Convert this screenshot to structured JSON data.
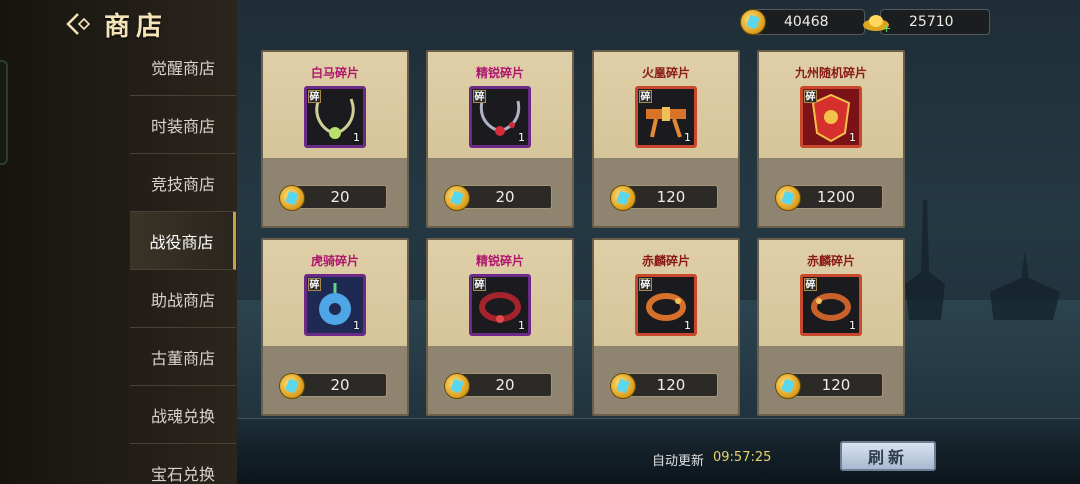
{
  "header": {
    "title": "商店",
    "back_icon": "back-arrow-icon"
  },
  "currency": {
    "coins": "40468",
    "ingots": "25710"
  },
  "sidebar": {
    "items": [
      {
        "label": "觉醒商店",
        "active": false
      },
      {
        "label": "时装商店",
        "active": false
      },
      {
        "label": "竞技商店",
        "active": false
      },
      {
        "label": "战役商店",
        "active": true
      },
      {
        "label": "助战商店",
        "active": false
      },
      {
        "label": "古董商店",
        "active": false
      },
      {
        "label": "战魂兑换",
        "active": false
      },
      {
        "label": "宝石兑换",
        "active": false
      }
    ]
  },
  "items": [
    {
      "name": "白马碎片",
      "frag": "碎",
      "qty": "1",
      "price": "20",
      "icon": "necklace-green-gem-icon"
    },
    {
      "name": "精锐碎片",
      "frag": "碎",
      "qty": "1",
      "price": "20",
      "icon": "necklace-red-gem-icon"
    },
    {
      "name": "火凰碎片",
      "frag": "碎",
      "qty": "1",
      "price": "120",
      "icon": "orange-belt-icon"
    },
    {
      "name": "九州随机碎片",
      "frag": "碎",
      "qty": "1",
      "price": "1200",
      "icon": "red-gold-emblem-icon"
    },
    {
      "name": "虎骑碎片",
      "frag": "碎",
      "qty": "1",
      "price": "20",
      "icon": "blue-jade-pendant-icon"
    },
    {
      "name": "精锐碎片",
      "frag": "碎",
      "qty": "1",
      "price": "20",
      "icon": "red-collar-icon"
    },
    {
      "name": "赤麟碎片",
      "frag": "碎",
      "qty": "1",
      "price": "120",
      "icon": "orange-bracelet-icon"
    },
    {
      "name": "赤麟碎片",
      "frag": "碎",
      "qty": "1",
      "price": "120",
      "icon": "orange-bracelet-icon"
    }
  ],
  "footer": {
    "refresh_label": "自动更新",
    "refresh_time": "09:57:25",
    "refresh_button": "刷新"
  }
}
